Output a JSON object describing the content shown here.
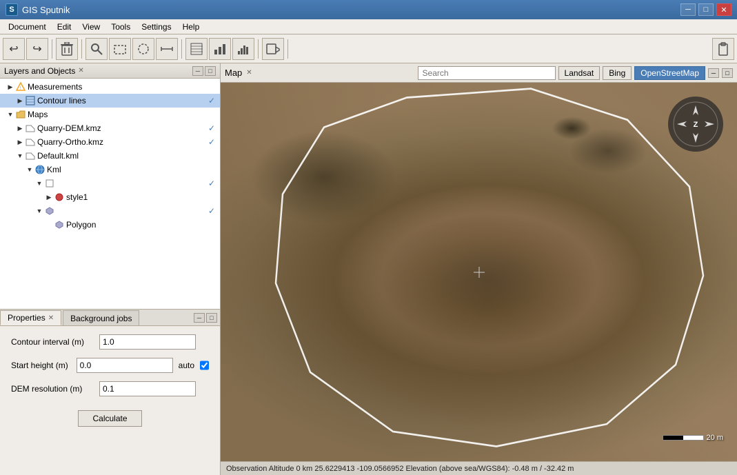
{
  "app": {
    "title": "GIS Sputnik",
    "logo": "S"
  },
  "titlebar": {
    "minimize": "─",
    "maximize": "□",
    "close": "✕"
  },
  "menubar": {
    "items": [
      "Document",
      "Edit",
      "View",
      "Tools",
      "Settings",
      "Help"
    ]
  },
  "toolbar": {
    "buttons": [
      "↩",
      "↪",
      "🗑",
      "🔍",
      "⬜",
      "◯",
      "📏",
      "▦",
      "⬛",
      "🎥",
      "📋"
    ]
  },
  "layers_panel": {
    "title": "Layers and Objects",
    "collapse_label": "─",
    "expand_label": "□",
    "tree": [
      {
        "indent": 1,
        "expand": "▶",
        "icon": "⚠",
        "label": "Measurements",
        "check": ""
      },
      {
        "indent": 2,
        "expand": "▶",
        "icon": "≡",
        "label": "Contour lines",
        "check": "✓",
        "selected": true
      },
      {
        "indent": 1,
        "expand": "▼",
        "icon": "🗂",
        "label": "Maps",
        "check": ""
      },
      {
        "indent": 2,
        "expand": "▶",
        "icon": "🗺",
        "label": "Quarry-DEM.kmz",
        "check": "✓"
      },
      {
        "indent": 2,
        "expand": "▶",
        "icon": "🗺",
        "label": "Quarry-Ortho.kmz",
        "check": "✓"
      },
      {
        "indent": 2,
        "expand": "▼",
        "icon": "📄",
        "label": "Default.kml",
        "check": ""
      },
      {
        "indent": 3,
        "expand": "▼",
        "icon": "🌐",
        "label": "Kml",
        "check": ""
      },
      {
        "indent": 4,
        "expand": "▼",
        "icon": "📁",
        "label": "",
        "check": "✓"
      },
      {
        "indent": 5,
        "expand": "▶",
        "icon": "🎨",
        "label": "style1",
        "check": ""
      },
      {
        "indent": 4,
        "expand": "▼",
        "icon": "⬡",
        "label": "",
        "check": "✓"
      },
      {
        "indent": 5,
        "expand": "",
        "icon": "⬡",
        "label": "Polygon",
        "check": ""
      }
    ]
  },
  "properties_panel": {
    "tabs": [
      {
        "label": "Properties",
        "active": true,
        "closeable": true
      },
      {
        "label": "Background jobs",
        "active": false,
        "closeable": false
      }
    ],
    "collapse_label": "─",
    "expand_label": "□",
    "fields": [
      {
        "label": "Contour interval (m)",
        "value": "1.0",
        "type": "text"
      },
      {
        "label": "Start height (m)",
        "value": "0.0",
        "type": "text",
        "extra": "auto",
        "checkbox": true
      },
      {
        "label": "DEM resolution (m)",
        "value": "0.1",
        "type": "text"
      }
    ],
    "calculate_btn": "Calculate"
  },
  "map_panel": {
    "title": "Map",
    "search_placeholder": "Search",
    "sources": [
      "Landsat",
      "Bing",
      "OpenStreetMap"
    ],
    "active_source": "OpenStreetMap",
    "collapse_label": "─",
    "expand_label": "□"
  },
  "status_bar": {
    "text": "Observation Altitude 0 km   25.6229413 -109.0566952  Elevation (above sea/WGS84): -0.48 m / -32.42 m"
  },
  "compass": {
    "arrows": [
      "▲",
      "▶",
      "▼",
      "◀"
    ]
  },
  "scale": {
    "label": "20 m"
  }
}
